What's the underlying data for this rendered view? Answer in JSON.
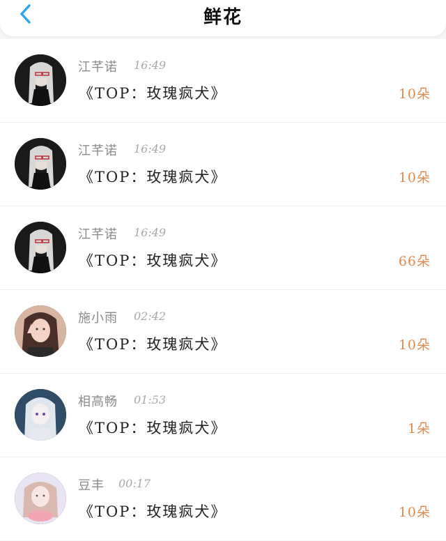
{
  "header": {
    "title": "鲜花",
    "accent": "#2ea3f2"
  },
  "list": [
    {
      "name": "江芊诺",
      "time": "16:49",
      "message": "《TOP：玫瑰疯犬》",
      "count": "10朵",
      "avatar": "dark-hair-white-girl"
    },
    {
      "name": "江芊诺",
      "time": "16:49",
      "message": "《TOP：玫瑰疯犬》",
      "count": "10朵",
      "avatar": "dark-hair-white-girl"
    },
    {
      "name": "江芊诺",
      "time": "16:49",
      "message": "《TOP：玫瑰疯犬》",
      "count": "66朵",
      "avatar": "dark-hair-white-girl"
    },
    {
      "name": "施小雨",
      "time": "02:42",
      "message": "《TOP：玫瑰疯犬》",
      "count": "10朵",
      "avatar": "girl-peace-sign"
    },
    {
      "name": "相高畅",
      "time": "01:53",
      "message": "《TOP：玫瑰疯犬》",
      "count": "1朵",
      "avatar": "anime-white-hair"
    },
    {
      "name": "豆丰",
      "time": "00:17",
      "message": "《TOP：玫瑰疯犬》",
      "count": "10朵",
      "avatar": "pastel-girl"
    }
  ],
  "colors": {
    "count": "#e38a4b",
    "name": "#8a8a8a",
    "message": "#222222"
  }
}
